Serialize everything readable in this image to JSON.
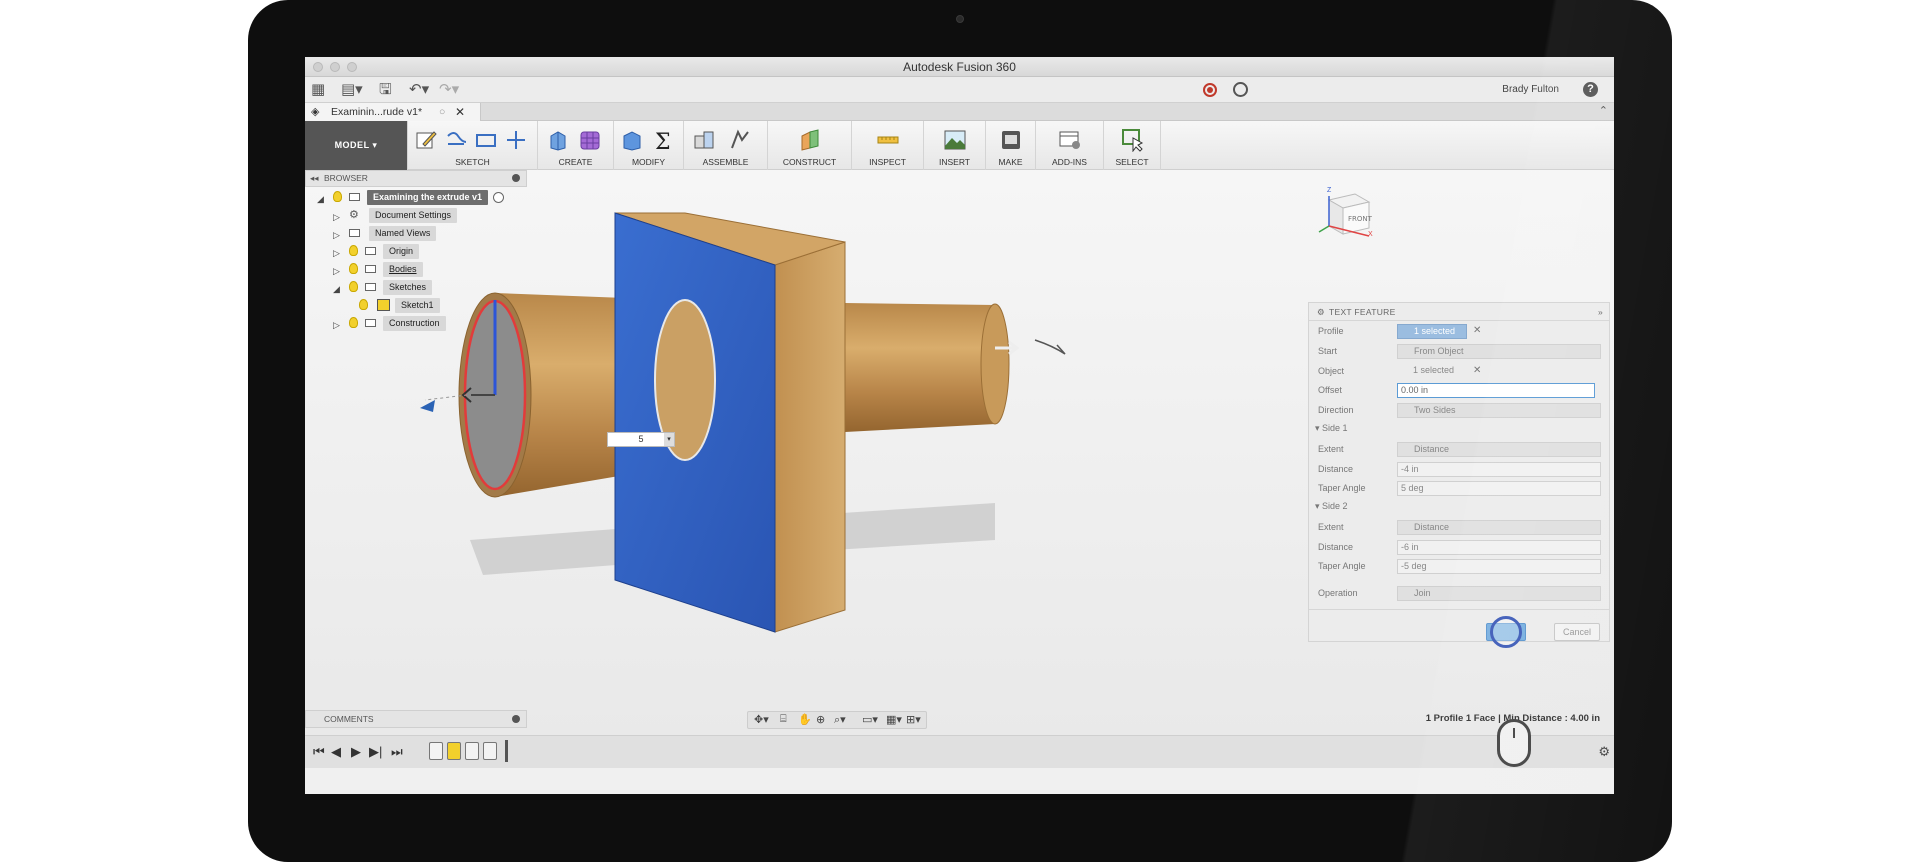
{
  "app": {
    "window_title": "Autodesk Fusion 360",
    "user_name": "Brady Fulton",
    "doc_tab_label": "Examinin...rude v1*"
  },
  "toolbar": {
    "workspace": "MODEL",
    "groups": [
      "SKETCH",
      "CREATE",
      "MODIFY",
      "ASSEMBLE",
      "CONSTRUCT",
      "INSPECT",
      "INSERT",
      "MAKE",
      "ADD-INS",
      "SELECT"
    ]
  },
  "browser": {
    "header": "BROWSER",
    "root": "Examining the extrude v1",
    "items": [
      "Document Settings",
      "Named Views",
      "Origin",
      "Bodies",
      "Sketches",
      "Sketch1",
      "Construction"
    ]
  },
  "viewcube": {
    "face_label": "FRONT"
  },
  "dimension_input": {
    "value": "5"
  },
  "feature_panel": {
    "title": "TEXT FEATURE",
    "profile_label": "Profile",
    "profile_value": "1 selected",
    "start_label": "Start",
    "start_value": "From Object",
    "object_label": "Object",
    "object_value": "1 selected",
    "offset_label": "Offset",
    "offset_value": "0.00 in",
    "direction_label": "Direction",
    "direction_value": "Two Sides",
    "side1_label": "Side 1",
    "side1_extent_label": "Extent",
    "side1_extent_value": "Distance",
    "side1_distance_label": "Distance",
    "side1_distance_value": "-4 in",
    "side1_taper_label": "Taper Angle",
    "side1_taper_value": "5 deg",
    "side2_label": "Side 2",
    "side2_extent_label": "Extent",
    "side2_extent_value": "Distance",
    "side2_distance_label": "Distance",
    "side2_distance_value": "-6 in",
    "side2_taper_label": "Taper Angle",
    "side2_taper_value": "-5 deg",
    "operation_label": "Operation",
    "operation_value": "Join",
    "cancel_label": "Cancel"
  },
  "comments": {
    "header": "COMMENTS"
  },
  "status_bar": {
    "text": "1 Profile 1 Face | Min Distance : 4.00 in"
  },
  "colors": {
    "plate_face": "#2f5fc4",
    "wood": "#c89a5a",
    "accent": "#5b9bd5"
  }
}
